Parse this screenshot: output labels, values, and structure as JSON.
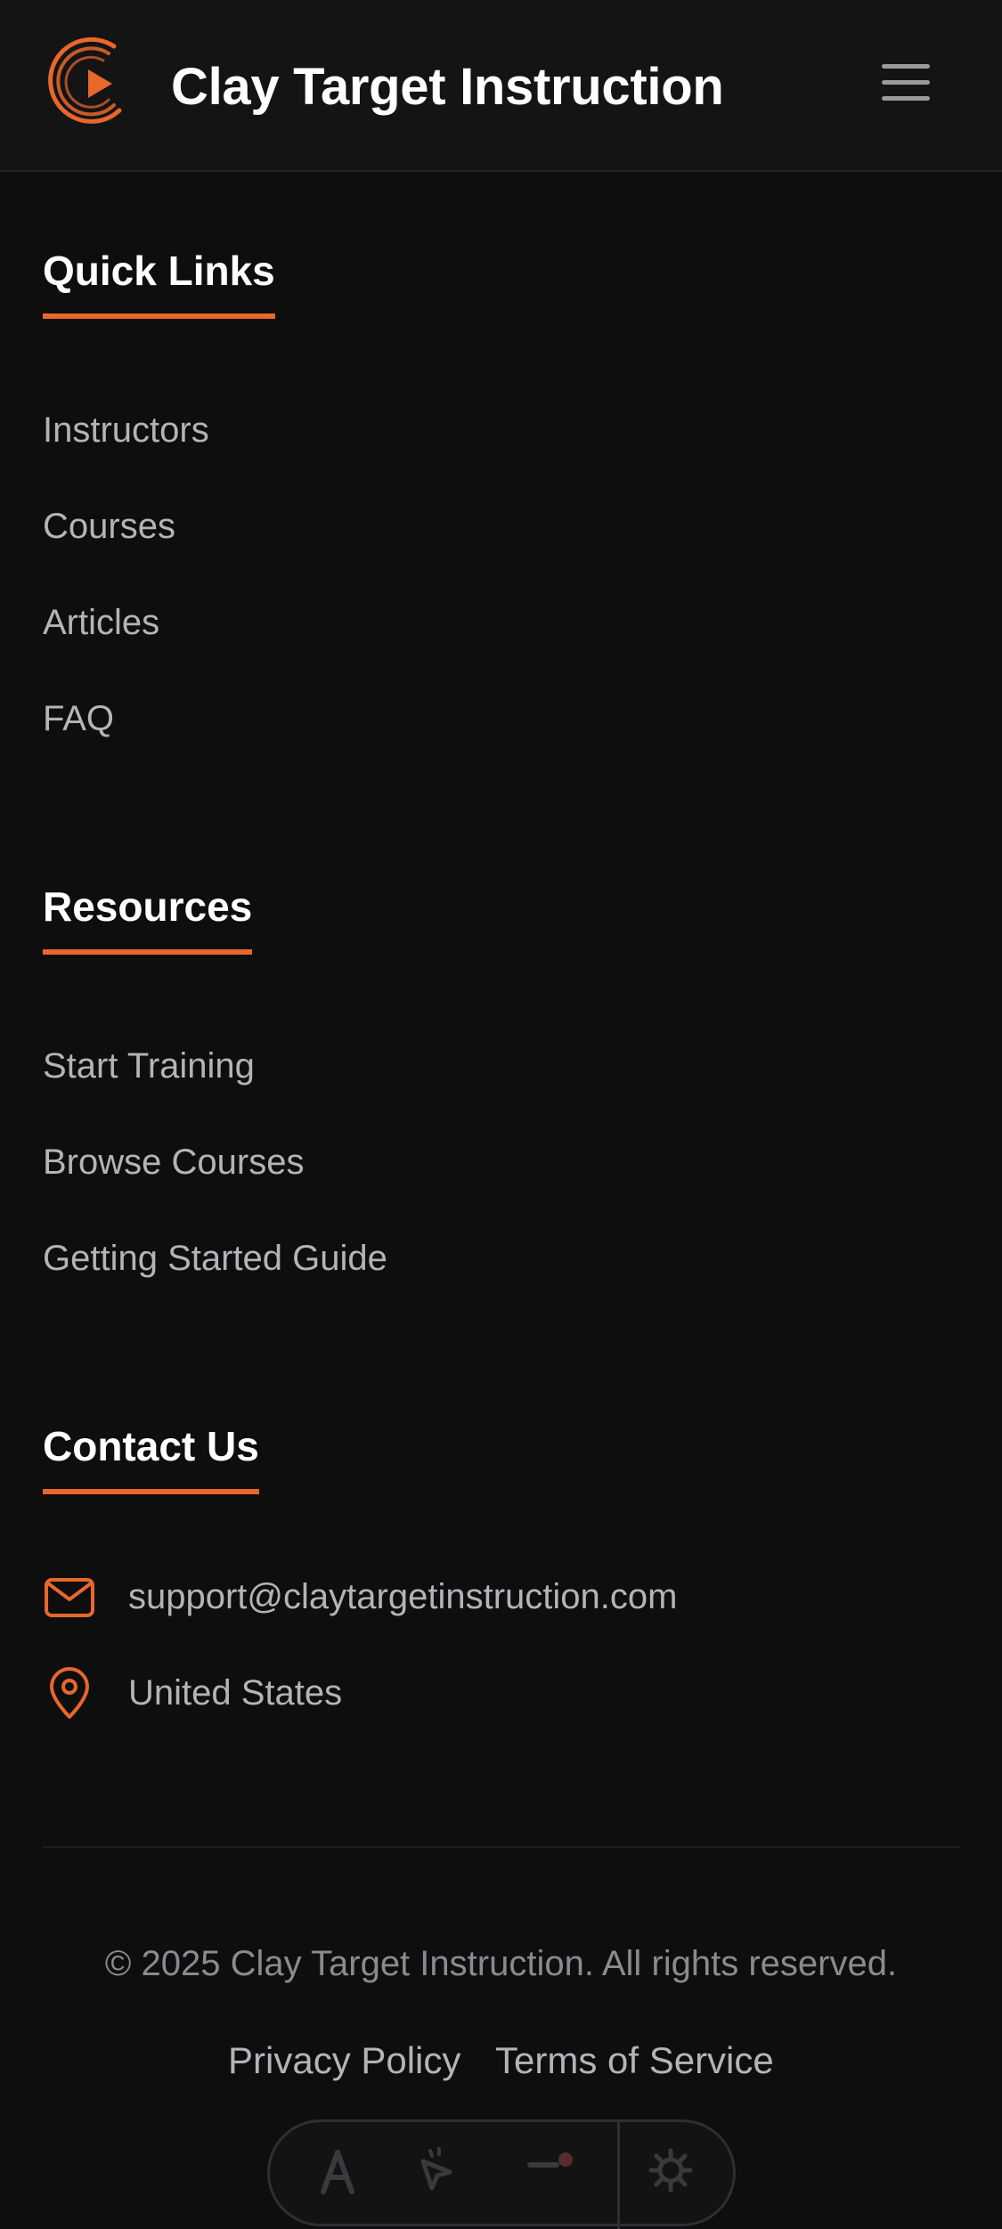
{
  "header": {
    "brand": "Clay Target Instruction",
    "logo_icon": "play-target-logo-icon",
    "menu_icon": "hamburger-menu-icon",
    "accent_color": "#e8672a"
  },
  "quick_links": {
    "title": "Quick Links",
    "items": [
      "Instructors",
      "Courses",
      "Articles",
      "FAQ"
    ]
  },
  "resources": {
    "title": "Resources",
    "items": [
      "Start Training",
      "Browse Courses",
      "Getting Started Guide"
    ]
  },
  "contact": {
    "title": "Contact Us",
    "email": "support@claytargetinstruction.com",
    "location": "United States",
    "email_icon": "mail-icon",
    "location_icon": "map-pin-icon"
  },
  "footer": {
    "copyright": "© 2025 Clay Target Instruction. All rights reserved.",
    "privacy": "Privacy Policy",
    "terms": "Terms of Service"
  },
  "toolbar": {
    "icons": [
      "text-icon",
      "pointer-icon",
      "menu-dot-icon",
      "gear-icon"
    ]
  }
}
